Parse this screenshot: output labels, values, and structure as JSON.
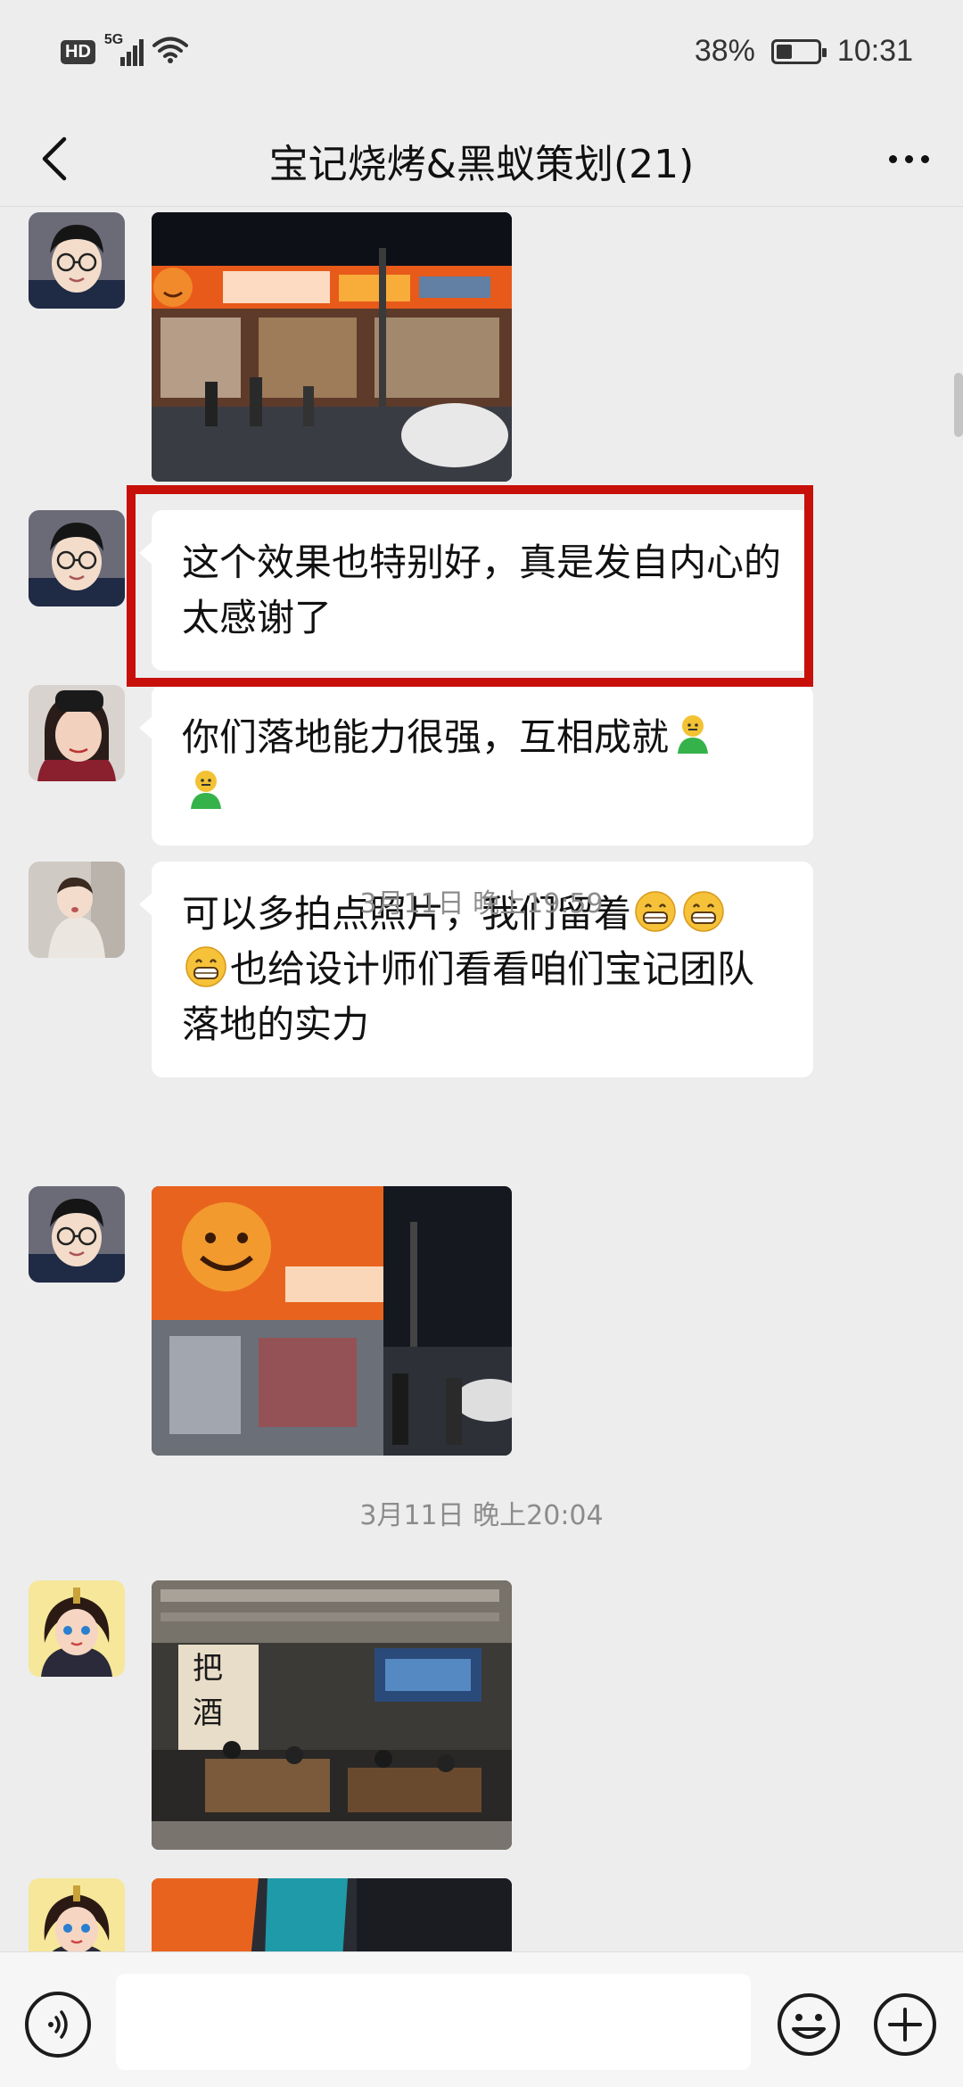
{
  "status_bar": {
    "hd_label": "HD",
    "network_label": "5G",
    "battery_text": "38%",
    "battery_level": 0.38,
    "time": "10:31"
  },
  "header": {
    "title": "宝记烧烤&黑蚁策划(21)",
    "back_icon": "chevron-left-icon",
    "more_icon": "more-dots-icon"
  },
  "messages": [
    {
      "type": "image",
      "sender_avatar": "avatar-cartoon-glasses",
      "alt": "photo-storefront-night"
    },
    {
      "type": "text",
      "sender_avatar": "avatar-cartoon-glasses",
      "text": "这个效果也特别好，真是发自内心的太感谢了"
    },
    {
      "type": "text",
      "sender_avatar": "avatar-woman-photo",
      "text": "你们落地能力很强，互相成就",
      "emojis": [
        "green-figure-emoji",
        "green-figure-emoji"
      ]
    },
    {
      "type": "text",
      "sender_avatar": "avatar-child-photo",
      "text_before": "可以多拍点照片，我们留着",
      "text_after": "也给设计师们看看咱们宝记团队落地的实力",
      "emojis": [
        "grin-emoji",
        "grin-emoji",
        "grin-emoji"
      ]
    },
    {
      "type": "image",
      "sender_avatar": "avatar-cartoon-glasses",
      "alt": "photo-storefront-smiley"
    },
    {
      "type": "image",
      "sender_avatar": "avatar-cartoon-girl",
      "alt": "photo-restaurant-interior"
    },
    {
      "type": "image",
      "sender_avatar": "avatar-cartoon-girl",
      "alt": "photo-partial"
    }
  ],
  "timestamps": [
    "3月11日 晚上19:59",
    "3月11日 晚上20:04"
  ],
  "colors": {
    "background": "#ededed",
    "bubble": "#ffffff",
    "highlight_border": "#c8100a"
  },
  "input_bar": {
    "voice_icon": "voice-icon",
    "emoji_icon": "emoji-smile-icon",
    "plus_icon": "plus-icon"
  }
}
